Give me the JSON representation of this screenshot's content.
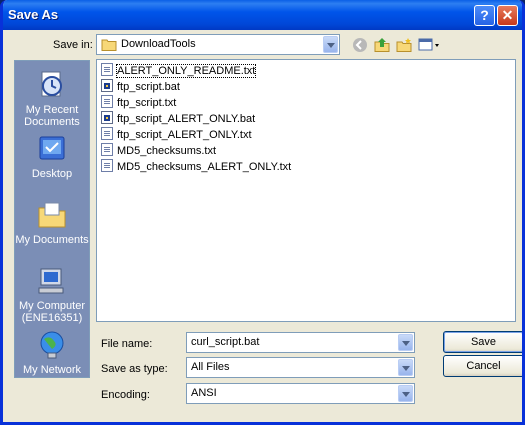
{
  "window": {
    "title": "Save As",
    "help_label": "?",
    "close_label": "✕"
  },
  "toolbar": {
    "save_in_label": "Save in:",
    "save_in_value": "DownloadTools",
    "icons": [
      "back-icon",
      "up-folder-icon",
      "new-folder-icon",
      "views-menu-icon"
    ]
  },
  "places": [
    {
      "name": "My Recent Documents",
      "line1": "My Recent",
      "line2": "Documents",
      "icon": "recent-documents-icon"
    },
    {
      "name": "Desktop",
      "line1": "Desktop",
      "line2": "",
      "icon": "desktop-icon"
    },
    {
      "name": "My Documents",
      "line1": "My Documents",
      "line2": "",
      "icon": "my-documents-icon"
    },
    {
      "name": "My Computer",
      "line1": "My Computer",
      "line2": "(ENE16351)",
      "icon": "my-computer-icon"
    },
    {
      "name": "My Network",
      "line1": "My Network",
      "line2": "",
      "icon": "my-network-icon"
    }
  ],
  "files": [
    {
      "name": "ALERT_ONLY_README.txt",
      "type": "txt",
      "focused": true
    },
    {
      "name": "ftp_script.bat",
      "type": "bat"
    },
    {
      "name": "ftp_script.txt",
      "type": "txt"
    },
    {
      "name": "ftp_script_ALERT_ONLY.bat",
      "type": "bat"
    },
    {
      "name": "ftp_script_ALERT_ONLY.txt",
      "type": "txt"
    },
    {
      "name": "MD5_checksums.txt",
      "type": "txt"
    },
    {
      "name": "MD5_checksums_ALERT_ONLY.txt",
      "type": "txt"
    }
  ],
  "form": {
    "file_name_label": "File name:",
    "file_name_value": "curl_script.bat",
    "save_as_type_label": "Save as type:",
    "save_as_type_value": "All Files",
    "encoding_label": "Encoding:",
    "encoding_value": "ANSI"
  },
  "buttons": {
    "save_label": "Save",
    "cancel_label": "Cancel"
  }
}
